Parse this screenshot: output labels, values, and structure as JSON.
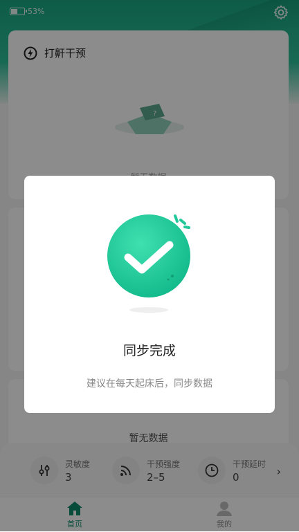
{
  "status": {
    "battery": "53%",
    "battery_level": 0.53
  },
  "card1": {
    "title": "打鼾干预",
    "empty": "暂无数据"
  },
  "card3": {
    "empty": "暂无数据"
  },
  "stats": [
    {
      "label": "灵敏度",
      "value": "3",
      "icon": "sliders-icon"
    },
    {
      "label": "干预强度",
      "value": "2–5",
      "icon": "signal-icon"
    },
    {
      "label": "干预延时",
      "value": "0",
      "icon": "clock-icon"
    }
  ],
  "tabs": [
    {
      "label": "首页",
      "active": true,
      "icon": "home-icon"
    },
    {
      "label": "我的",
      "active": false,
      "icon": "profile-icon"
    }
  ],
  "dialog": {
    "title": "同步完成",
    "subtitle": "建议在每天起床后，同步数据"
  },
  "colors": {
    "accent": "#1aa884",
    "check_green": "#22c79a"
  }
}
